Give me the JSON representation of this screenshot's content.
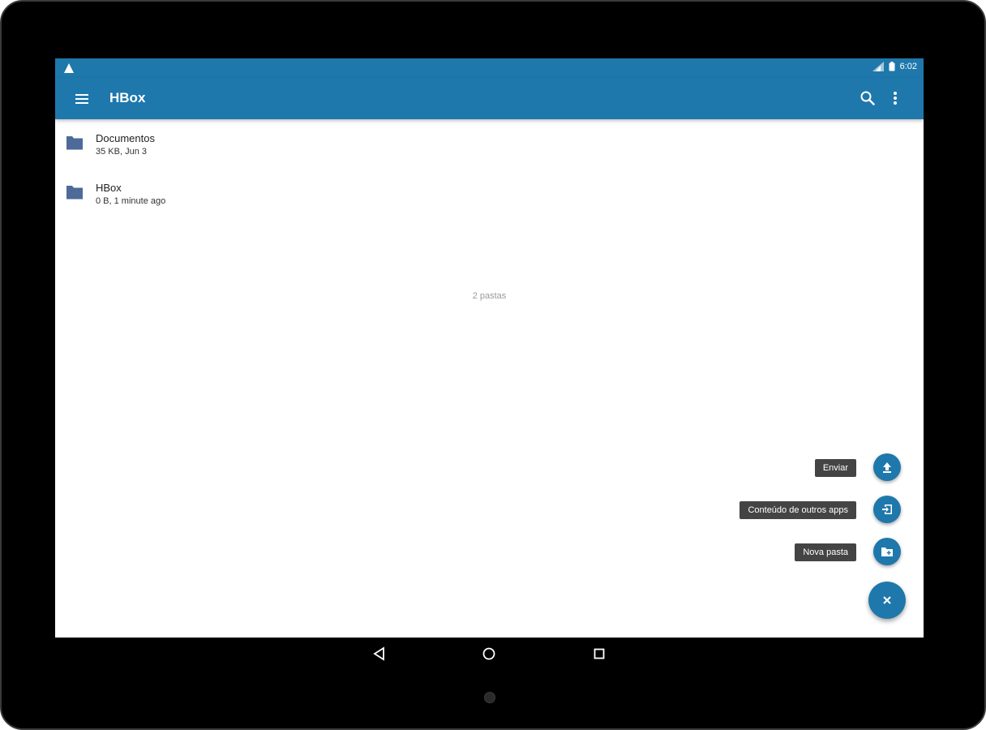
{
  "status_bar": {
    "time": "6:02",
    "alert_icon": "warning-triangle-icon",
    "signal_icon": "signal-icon",
    "battery_icon": "battery-icon"
  },
  "toolbar": {
    "title": "HBox",
    "menu_icon": "menu-icon",
    "search_icon": "search-icon",
    "more_icon": "more-vert-icon"
  },
  "files": [
    {
      "name": "Documentos",
      "meta": "35 KB, Jun 3",
      "icon": "folder-icon"
    },
    {
      "name": "HBox",
      "meta": "0 B, 1 minute ago",
      "icon": "folder-icon"
    }
  ],
  "footer_count": "2 pastas",
  "fab_menu": {
    "actions": [
      {
        "label": "Enviar",
        "icon": "upload-icon"
      },
      {
        "label": "Conteúdo de outros apps",
        "icon": "input-icon"
      },
      {
        "label": "Nova pasta",
        "icon": "create-folder-icon"
      }
    ],
    "close_icon": "close-icon"
  },
  "colors": {
    "primary": "#1e78ab",
    "folder": "#4d6a98",
    "label_bg": "#444444"
  }
}
